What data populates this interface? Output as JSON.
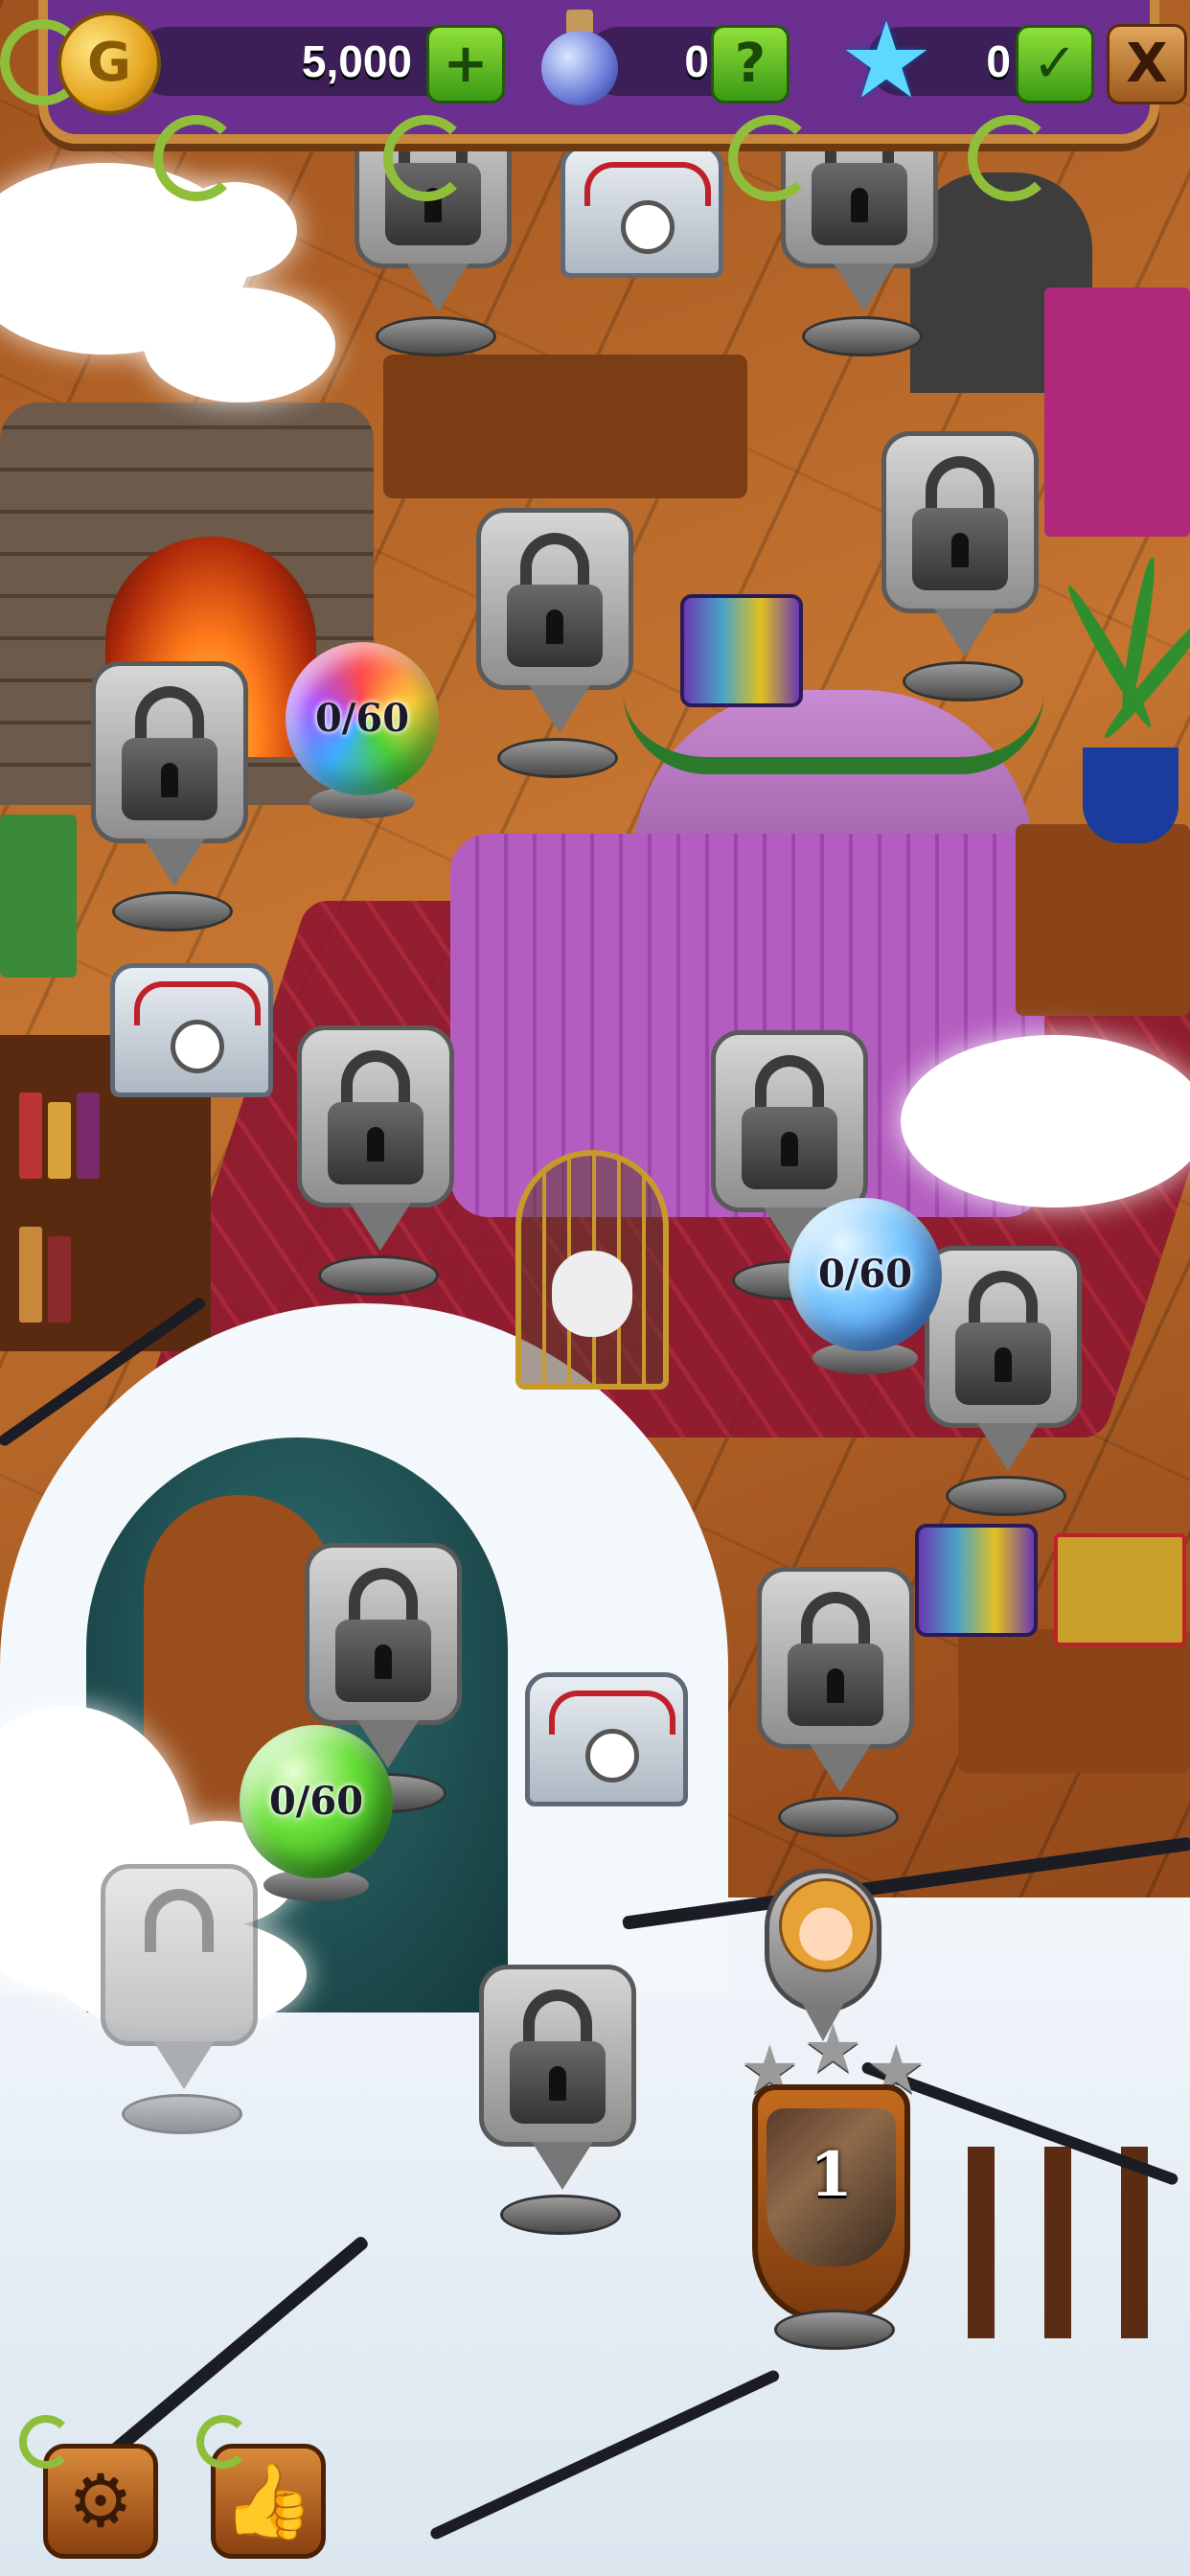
{
  "hud": {
    "coins": "5,000",
    "coin_symbol": "G",
    "add_coins_symbol": "+",
    "potions": "0",
    "potion_help_symbol": "?",
    "stars": "0",
    "stars_check_symbol": "✓",
    "close_symbol": "X"
  },
  "map": {
    "orb_rainbow_label": "0/60",
    "orb_blue_label": "0/60",
    "orb_green_label": "0/60",
    "current_level_number": "1"
  },
  "bottom_bar": {
    "settings_icon": "gear-icon",
    "like_icon": "thumbs-up-icon"
  },
  "colors": {
    "hud_background": "#6a2f8f",
    "hud_frame": "#c9893c",
    "action_green": "#3a9a14"
  }
}
